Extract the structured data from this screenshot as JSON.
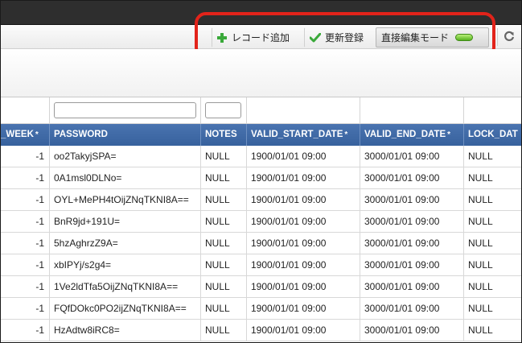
{
  "toolbar": {
    "add_record_label": "レコード追加",
    "update_register_label": "更新登録",
    "direct_edit_label": "直接編集モード"
  },
  "colors": {
    "header_bg": "#3d68a6",
    "callout_border": "#e2231a",
    "add_icon": "#3aa93a",
    "check_icon": "#3aa93a",
    "toggle_on": "#6cc62c"
  },
  "icons": {
    "add": "plus-icon",
    "update": "check-icon",
    "toggle": "toggle-led-icon",
    "refresh": "refresh-icon"
  },
  "table": {
    "columns": [
      {
        "label": "_WEEK",
        "required": "*"
      },
      {
        "label": "PASSWORD",
        "required": ""
      },
      {
        "label": "NOTES",
        "required": ""
      },
      {
        "label": "VALID_START_DATE",
        "required": "*"
      },
      {
        "label": "VALID_END_DATE",
        "required": "*"
      },
      {
        "label": "LOCK_DAT",
        "required": ""
      }
    ],
    "rows": [
      {
        "week": "-1",
        "password": "oo2TakyjSPA=",
        "notes": "NULL",
        "start": "1900/01/01 09:00",
        "end": "3000/01/01 09:00",
        "lock": "NULL"
      },
      {
        "week": "-1",
        "password": "0A1msl0DLNo=",
        "notes": "NULL",
        "start": "1900/01/01 09:00",
        "end": "3000/01/01 09:00",
        "lock": "NULL"
      },
      {
        "week": "-1",
        "password": "OYL+MePH4tOijZNqTKNI8A==",
        "notes": "NULL",
        "start": "1900/01/01 09:00",
        "end": "3000/01/01 09:00",
        "lock": "NULL"
      },
      {
        "week": "-1",
        "password": "BnR9jd+191U=",
        "notes": "NULL",
        "start": "1900/01/01 09:00",
        "end": "3000/01/01 09:00",
        "lock": "NULL"
      },
      {
        "week": "-1",
        "password": "5hzAghrzZ9A=",
        "notes": "NULL",
        "start": "1900/01/01 09:00",
        "end": "3000/01/01 09:00",
        "lock": "NULL"
      },
      {
        "week": "-1",
        "password": "xbIPYj/s2g4=",
        "notes": "NULL",
        "start": "1900/01/01 09:00",
        "end": "3000/01/01 09:00",
        "lock": "NULL"
      },
      {
        "week": "-1",
        "password": "1Ve2ldTfa5OijZNqTKNI8A==",
        "notes": "NULL",
        "start": "1900/01/01 09:00",
        "end": "3000/01/01 09:00",
        "lock": "NULL"
      },
      {
        "week": "-1",
        "password": "FQfDOkc0PO2ijZNqTKNI8A==",
        "notes": "NULL",
        "start": "1900/01/01 09:00",
        "end": "3000/01/01 09:00",
        "lock": "NULL"
      },
      {
        "week": "-1",
        "password": "HzAdtw8iRC8=",
        "notes": "NULL",
        "start": "1900/01/01 09:00",
        "end": "3000/01/01 09:00",
        "lock": "NULL"
      }
    ]
  }
}
